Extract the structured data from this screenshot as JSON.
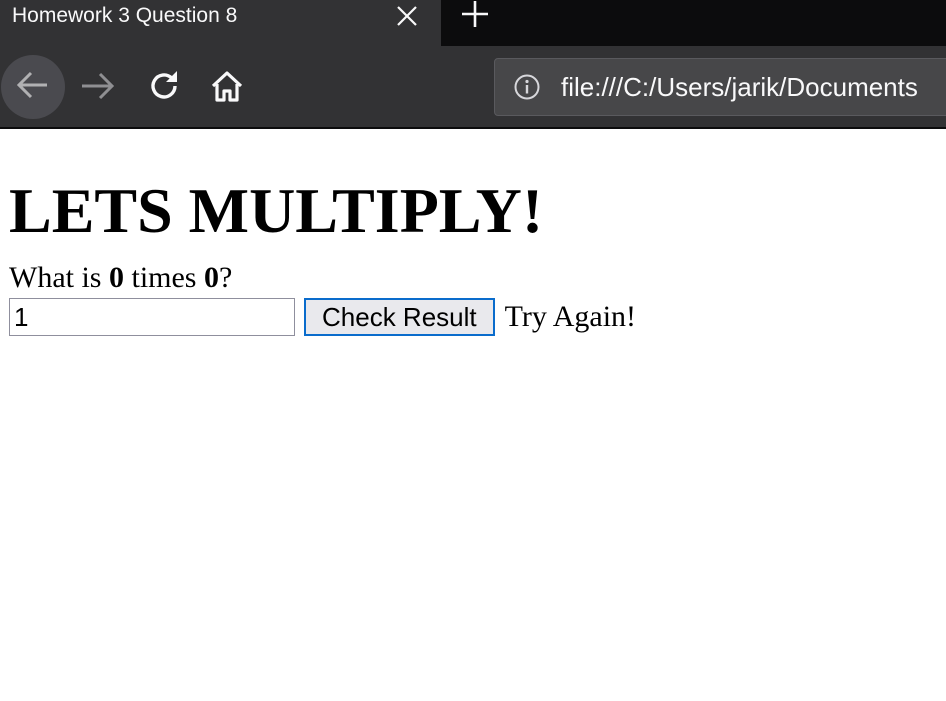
{
  "browser": {
    "tab": {
      "title": "Homework 3 Question 8",
      "close_icon": "close-icon"
    },
    "newtab_icon": "plus-icon",
    "nav": {
      "back_icon": "back-arrow-icon",
      "forward_icon": "forward-arrow-icon",
      "reload_icon": "reload-icon",
      "home_icon": "home-icon"
    },
    "urlbar": {
      "info_icon": "info-icon",
      "url": "file:///C:/Users/jarik/Documents"
    },
    "colors": {
      "tabstrip_bg": "#0c0c0d",
      "toolbar_bg": "#323234",
      "button_focus_border": "#0a6ccc"
    }
  },
  "page": {
    "heading": "LETS MULTIPLY!",
    "question": {
      "prefix": "What is ",
      "operand_a": "0",
      "middle": " times ",
      "operand_b": "0",
      "suffix": "?"
    },
    "answer_input": {
      "value": "1"
    },
    "check_button_label": "Check Result",
    "result_message": "Try Again!"
  }
}
